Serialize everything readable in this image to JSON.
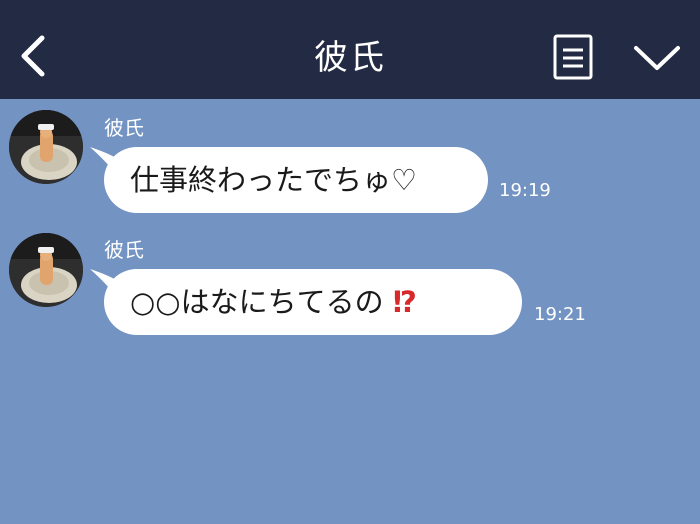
{
  "header": {
    "title": "彼氏"
  },
  "messages": [
    {
      "sender": "彼氏",
      "text": "仕事終わったでちゅ♡",
      "time": "19:19"
    },
    {
      "sender": "彼氏",
      "text": "○○はなにちてるの",
      "emoji": "⁉",
      "time": "19:21"
    }
  ],
  "colors": {
    "header_bg": "#232b44",
    "chat_bg": "#7393c3",
    "bubble_bg": "#ffffff",
    "emoji_red": "#d7282a"
  },
  "icons": {
    "back": "chevron-left-icon",
    "menu": "document-menu-icon",
    "more": "chevron-down-icon"
  }
}
